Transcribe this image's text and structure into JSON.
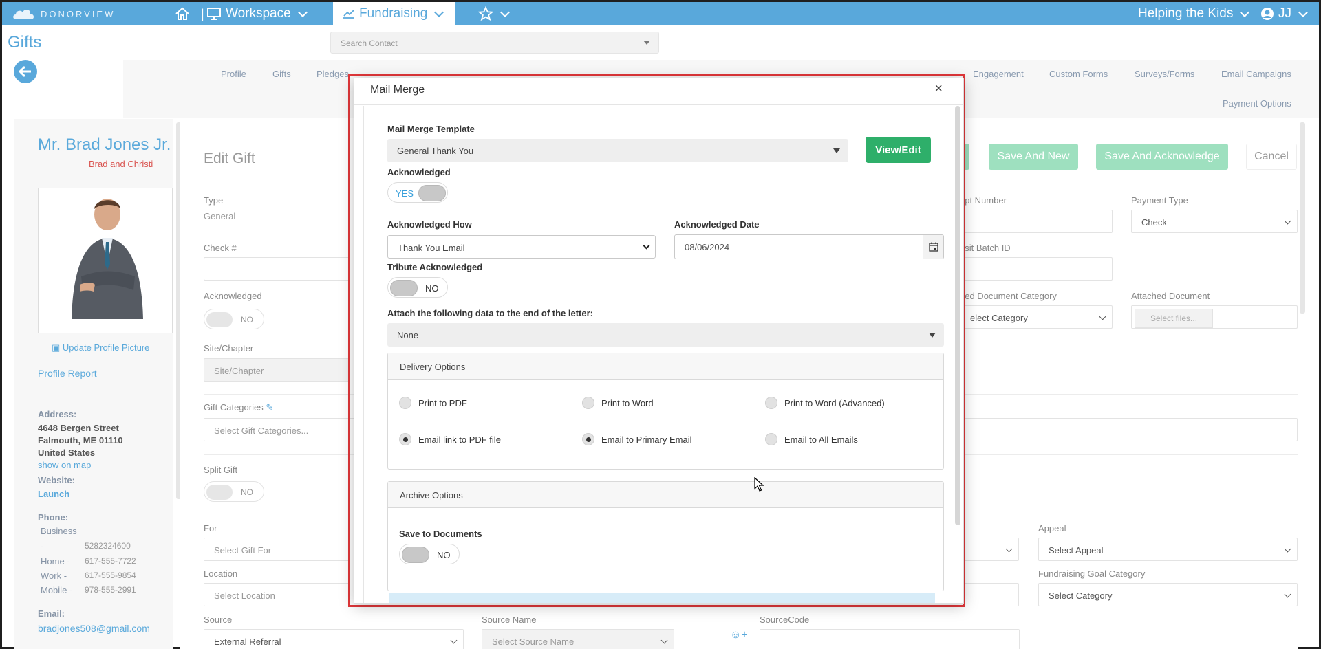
{
  "topbar": {
    "logo_text": "DONORVIEW",
    "workspace": "Workspace",
    "fundraising": "Fundraising",
    "org": "Helping the Kids",
    "user": "JJ"
  },
  "page": {
    "title": "Gifts",
    "search_placeholder": "Search Contact"
  },
  "tabs": [
    "Profile",
    "Gifts",
    "Pledges",
    "Engagement",
    "Custom Forms",
    "Surveys/Forms",
    "Email Campaigns",
    "Payment Options"
  ],
  "profile": {
    "name": "Mr. Brad Jones Jr.",
    "subtitle": "Brad and Christi",
    "update_picture": "Update Profile Picture",
    "profile_report": "Profile Report",
    "address_label": "Address:",
    "address_line1": "4648 Bergen Street",
    "address_line2": "Falmouth, ME 01110",
    "address_line3": "United States",
    "show_on_map": "show on map",
    "website_label": "Website:",
    "website_link": "Launch",
    "phone_label": "Phone:",
    "phones": [
      {
        "type": "Business",
        "number": ""
      },
      {
        "type": "-",
        "number": "5282324600"
      },
      {
        "type": "Home -",
        "number": "617-555-7722"
      },
      {
        "type": "Work -",
        "number": "617-555-9854"
      },
      {
        "type": "Mobile -",
        "number": "978-555-2991"
      }
    ],
    "email_label": "Email:",
    "email": "bradjones508@gmail.com"
  },
  "form": {
    "heading": "Edit Gift",
    "type_label": "Type",
    "type_value": "General",
    "check_label": "Check #",
    "ack_label": "Acknowledged",
    "ack_toggle": "NO",
    "site_label": "Site/Chapter",
    "site_placeholder": "Site/Chapter",
    "gift_cat_label": "Gift Categories",
    "gift_cat_placeholder": "Select Gift Categories...",
    "split_label": "Split Gift",
    "split_toggle": "NO",
    "for_label": "For",
    "for_placeholder": "Select Gift For",
    "location_label": "Location",
    "location_placeholder": "Select Location",
    "source_label": "Source",
    "source_value": "External Referral",
    "source_name_label": "Source Name",
    "source_name_placeholder": "Select Source Name",
    "source_code_label": "SourceCode",
    "receipt_label": "ept Number",
    "payment_type_label": "Payment Type",
    "payment_type_value": "Check",
    "deposit_label": "esit Batch ID",
    "attached_cat_label": "hed Document Category",
    "attached_cat_value": "elect Category",
    "attached_doc_label": "Attached Document",
    "select_files": "Select files...",
    "appeal_label": "Appeal",
    "appeal_placeholder": "Select Appeal",
    "goal_label": "Fundraising Goal Category",
    "goal_placeholder": "Select Category",
    "btn_save_new": "Save And New",
    "btn_save_ack": "Save And Acknowledge",
    "btn_cancel": "Cancel"
  },
  "modal": {
    "title": "Mail Merge",
    "close": "×",
    "template_label": "Mail Merge Template",
    "template_value": "General Thank You",
    "view_edit": "View/Edit",
    "ack_label": "Acknowledged",
    "ack_toggle": "YES",
    "ack_how_label": "Acknowledged How",
    "ack_how_value": "Thank You Email",
    "ack_date_label": "Acknowledged Date",
    "ack_date_value": "08/06/2024",
    "tribute_label": "Tribute Acknowledged",
    "tribute_toggle": "NO",
    "attach_label": "Attach the following data to the end of the letter:",
    "attach_value": "None",
    "delivery_title": "Delivery Options",
    "delivery": [
      {
        "label": "Print to PDF",
        "checked": false
      },
      {
        "label": "Print to Word",
        "checked": false
      },
      {
        "label": "Print to Word (Advanced)",
        "checked": false
      },
      {
        "label": "Email link to PDF file",
        "checked": true
      },
      {
        "label": "Email to Primary Email",
        "checked": true
      },
      {
        "label": "Email to All Emails",
        "checked": false
      }
    ],
    "archive_title": "Archive Options",
    "save_docs_label": "Save to Documents",
    "save_docs_toggle": "NO"
  },
  "colors": {
    "brand_blue": "#59a8db",
    "green": "#2eaf6a",
    "highlight_red": "#e2373a"
  }
}
